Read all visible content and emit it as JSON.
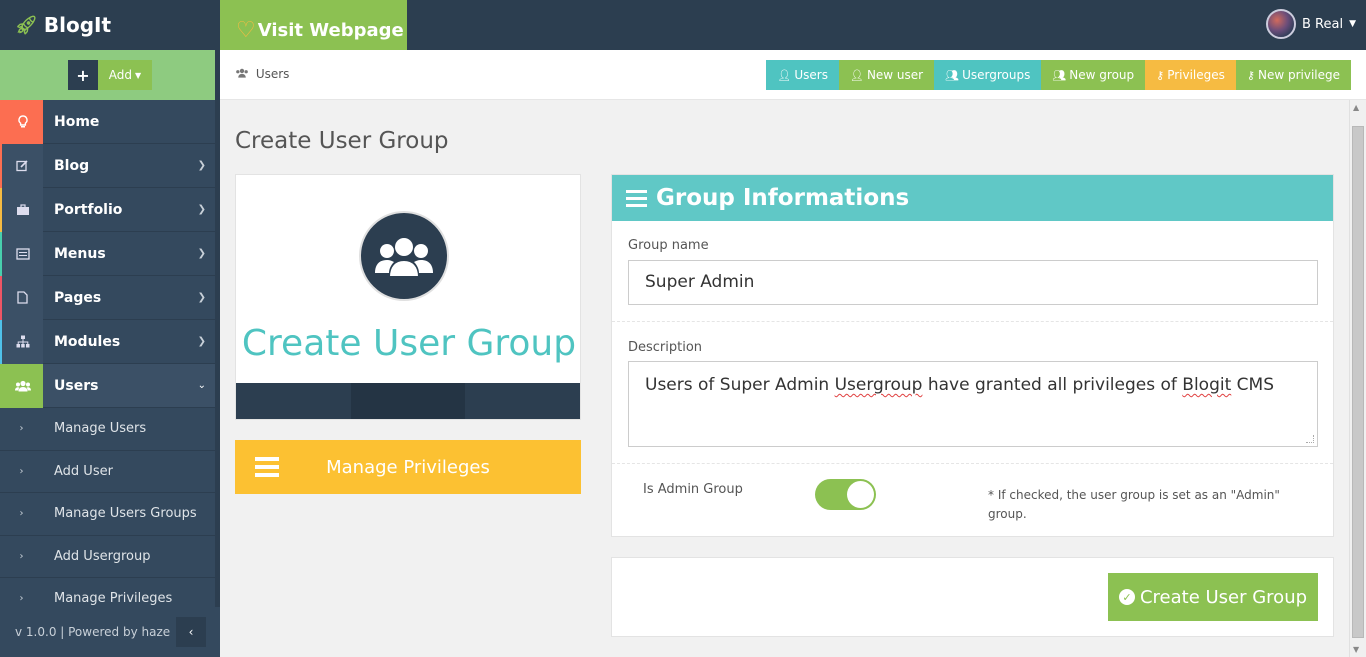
{
  "brand": {
    "name": "BlogIt"
  },
  "topbar": {
    "visit_label": "Visit Webpage"
  },
  "user": {
    "name": "B Real"
  },
  "add_menu": {
    "plus": "+",
    "label": "Add"
  },
  "sidebar": {
    "items": [
      {
        "label": "Home",
        "icon": "lightbulb-icon"
      },
      {
        "label": "Blog",
        "icon": "edit-icon"
      },
      {
        "label": "Portfolio",
        "icon": "briefcase-icon"
      },
      {
        "label": "Menus",
        "icon": "list-icon"
      },
      {
        "label": "Pages",
        "icon": "file-icon"
      },
      {
        "label": "Modules",
        "icon": "sitemap-icon"
      },
      {
        "label": "Users",
        "icon": "users-icon"
      }
    ],
    "subitems": [
      {
        "label": "Manage Users"
      },
      {
        "label": "Add User"
      },
      {
        "label": "Manage Users Groups"
      },
      {
        "label": "Add Usergroup"
      },
      {
        "label": "Manage Privileges"
      }
    ],
    "footer": "v 1.0.0 | Powered by haze"
  },
  "breadcrumb": {
    "current": "Users"
  },
  "quick_actions": [
    {
      "label": "Users",
      "color": "#4fc4c1"
    },
    {
      "label": "New user",
      "color": "#8cc152"
    },
    {
      "label": "Usergroups",
      "color": "#4fc4c1"
    },
    {
      "label": "New group",
      "color": "#8cc152"
    },
    {
      "label": "Privileges",
      "color": "#f6bb42"
    },
    {
      "label": "New privilege",
      "color": "#8cc152"
    }
  ],
  "page": {
    "title": "Create User Group"
  },
  "card": {
    "title": "Create User Group"
  },
  "manage_privileges": {
    "label": "Manage Privileges"
  },
  "form": {
    "heading": "Group Informations",
    "group_name_label": "Group name",
    "group_name_value": "Super Admin",
    "description_label": "Description",
    "description_pre": "Users of Super Admin ",
    "description_word1": "Usergroup",
    "description_mid": " have granted all privileges of ",
    "description_word2": "Blogit",
    "description_post": " CMS",
    "is_admin_label": "Is Admin Group",
    "is_admin_checked": true,
    "is_admin_help": "* If checked, the user group is set as an \"Admin\" group."
  },
  "submit": {
    "label": "Create User Group"
  },
  "colors": {
    "sidebar": "#34495e",
    "accent_green": "#8cc152",
    "accent_teal": "#4fc4c1",
    "accent_yellow": "#fcc132",
    "home_red": "#fc6e51"
  }
}
